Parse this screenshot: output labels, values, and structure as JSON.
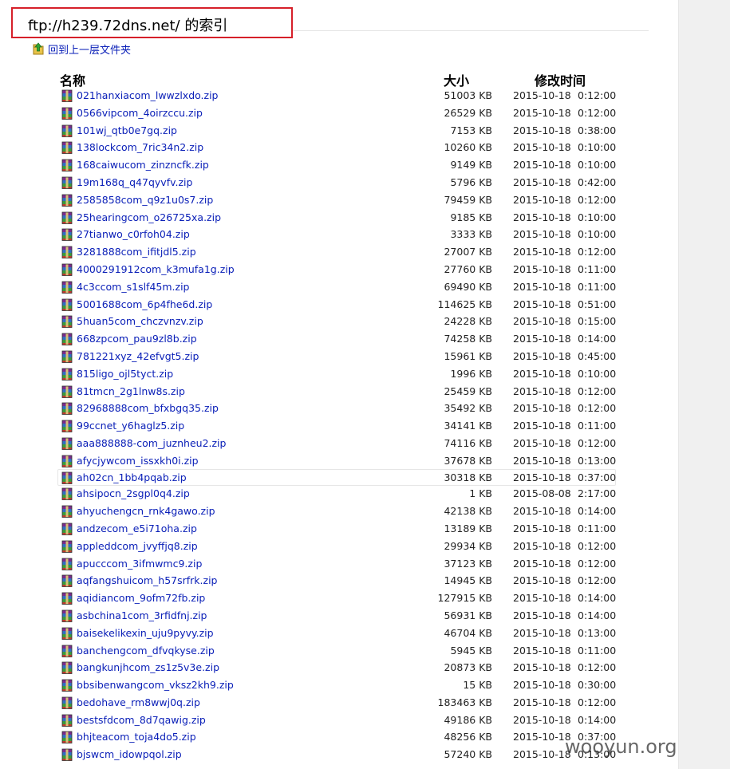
{
  "page": {
    "title": "ftp://h239.72dns.net/ 的索引",
    "up_link": "回到上一层文件夹"
  },
  "columns": {
    "name": "名称",
    "size": "大小",
    "modified": "修改时间"
  },
  "icons": {
    "up": "folder-up-icon",
    "file": "winrar-archive-icon"
  },
  "files": [
    {
      "name": "021hanxiacom_lwwzlxdo.zip",
      "size": "51003 KB",
      "date": "2015-10-18",
      "time": "0:12:00"
    },
    {
      "name": "0566vipcom_4oirzccu.zip",
      "size": "26529 KB",
      "date": "2015-10-18",
      "time": "0:12:00"
    },
    {
      "name": "101wj_qtb0e7gq.zip",
      "size": "7153 KB",
      "date": "2015-10-18",
      "time": "0:38:00"
    },
    {
      "name": "138lockcom_7ric34n2.zip",
      "size": "10260 KB",
      "date": "2015-10-18",
      "time": "0:10:00"
    },
    {
      "name": "168caiwucom_zinzncfk.zip",
      "size": "9149 KB",
      "date": "2015-10-18",
      "time": "0:10:00"
    },
    {
      "name": "19m168q_q47qyvfv.zip",
      "size": "5796 KB",
      "date": "2015-10-18",
      "time": "0:42:00"
    },
    {
      "name": "2585858com_q9z1u0s7.zip",
      "size": "79459 KB",
      "date": "2015-10-18",
      "time": "0:12:00"
    },
    {
      "name": "25hearingcom_o26725xa.zip",
      "size": "9185 KB",
      "date": "2015-10-18",
      "time": "0:10:00"
    },
    {
      "name": "27tianwo_c0rfoh04.zip",
      "size": "3333 KB",
      "date": "2015-10-18",
      "time": "0:10:00"
    },
    {
      "name": "3281888com_ifitjdl5.zip",
      "size": "27007 KB",
      "date": "2015-10-18",
      "time": "0:12:00"
    },
    {
      "name": "4000291912com_k3mufa1g.zip",
      "size": "27760 KB",
      "date": "2015-10-18",
      "time": "0:11:00"
    },
    {
      "name": "4c3ccom_s1slf45m.zip",
      "size": "69490 KB",
      "date": "2015-10-18",
      "time": "0:11:00"
    },
    {
      "name": "5001688com_6p4fhe6d.zip",
      "size": "114625 KB",
      "date": "2015-10-18",
      "time": "0:51:00"
    },
    {
      "name": "5huan5com_chczvnzv.zip",
      "size": "24228 KB",
      "date": "2015-10-18",
      "time": "0:15:00"
    },
    {
      "name": "668zpcom_pau9zl8b.zip",
      "size": "74258 KB",
      "date": "2015-10-18",
      "time": "0:14:00"
    },
    {
      "name": "781221xyz_42efvgt5.zip",
      "size": "15961 KB",
      "date": "2015-10-18",
      "time": "0:45:00"
    },
    {
      "name": "815ligo_ojl5tyct.zip",
      "size": "1996 KB",
      "date": "2015-10-18",
      "time": "0:10:00"
    },
    {
      "name": "81tmcn_2g1lnw8s.zip",
      "size": "25459 KB",
      "date": "2015-10-18",
      "time": "0:12:00"
    },
    {
      "name": "82968888com_bfxbgq35.zip",
      "size": "35492 KB",
      "date": "2015-10-18",
      "time": "0:12:00"
    },
    {
      "name": "99ccnet_y6haglz5.zip",
      "size": "34141 KB",
      "date": "2015-10-18",
      "time": "0:11:00"
    },
    {
      "name": "aaa888888-com_juznheu2.zip",
      "size": "74116 KB",
      "date": "2015-10-18",
      "time": "0:12:00"
    },
    {
      "name": "afycjywcom_issxkh0i.zip",
      "size": "37678 KB",
      "date": "2015-10-18",
      "time": "0:13:00"
    },
    {
      "name": "ah02cn_1bb4pqab.zip",
      "size": "30318 KB",
      "date": "2015-10-18",
      "time": "0:37:00"
    },
    {
      "name": "ahsipocn_2sgpl0q4.zip",
      "size": "1 KB",
      "date": "2015-08-08",
      "time": "2:17:00"
    },
    {
      "name": "ahyuchengcn_rnk4gawo.zip",
      "size": "42138 KB",
      "date": "2015-10-18",
      "time": "0:14:00"
    },
    {
      "name": "andzecom_e5i71oha.zip",
      "size": "13189 KB",
      "date": "2015-10-18",
      "time": "0:11:00"
    },
    {
      "name": "appleddcom_jvyffjq8.zip",
      "size": "29934 KB",
      "date": "2015-10-18",
      "time": "0:12:00"
    },
    {
      "name": "apucccom_3ifmwmc9.zip",
      "size": "37123 KB",
      "date": "2015-10-18",
      "time": "0:12:00"
    },
    {
      "name": "aqfangshuicom_h57srfrk.zip",
      "size": "14945 KB",
      "date": "2015-10-18",
      "time": "0:12:00"
    },
    {
      "name": "aqidiancom_9ofm72fb.zip",
      "size": "127915 KB",
      "date": "2015-10-18",
      "time": "0:14:00"
    },
    {
      "name": "asbchina1com_3rfidfnj.zip",
      "size": "56931 KB",
      "date": "2015-10-18",
      "time": "0:14:00"
    },
    {
      "name": "baisekelikexin_uju9pyvy.zip",
      "size": "46704 KB",
      "date": "2015-10-18",
      "time": "0:13:00"
    },
    {
      "name": "banchengcom_dfvqkyse.zip",
      "size": "5945 KB",
      "date": "2015-10-18",
      "time": "0:11:00"
    },
    {
      "name": "bangkunjhcom_zs1z5v3e.zip",
      "size": "20873 KB",
      "date": "2015-10-18",
      "time": "0:12:00"
    },
    {
      "name": "bbsibenwangcom_vksz2kh9.zip",
      "size": "15 KB",
      "date": "2015-10-18",
      "time": "0:30:00"
    },
    {
      "name": "bedohave_rm8wwj0q.zip",
      "size": "183463 KB",
      "date": "2015-10-18",
      "time": "0:12:00"
    },
    {
      "name": "bestsfdcom_8d7qawig.zip",
      "size": "49186 KB",
      "date": "2015-10-18",
      "time": "0:14:00"
    },
    {
      "name": "bhjteacom_toja4do5.zip",
      "size": "48256 KB",
      "date": "2015-10-18",
      "time": "0:37:00"
    },
    {
      "name": "bjswcm_idowpqol.zip",
      "size": "57240 KB",
      "date": "2015-10-18",
      "time": "0:13:00"
    }
  ],
  "highlight_index": 22,
  "watermark": "wooyun.org"
}
